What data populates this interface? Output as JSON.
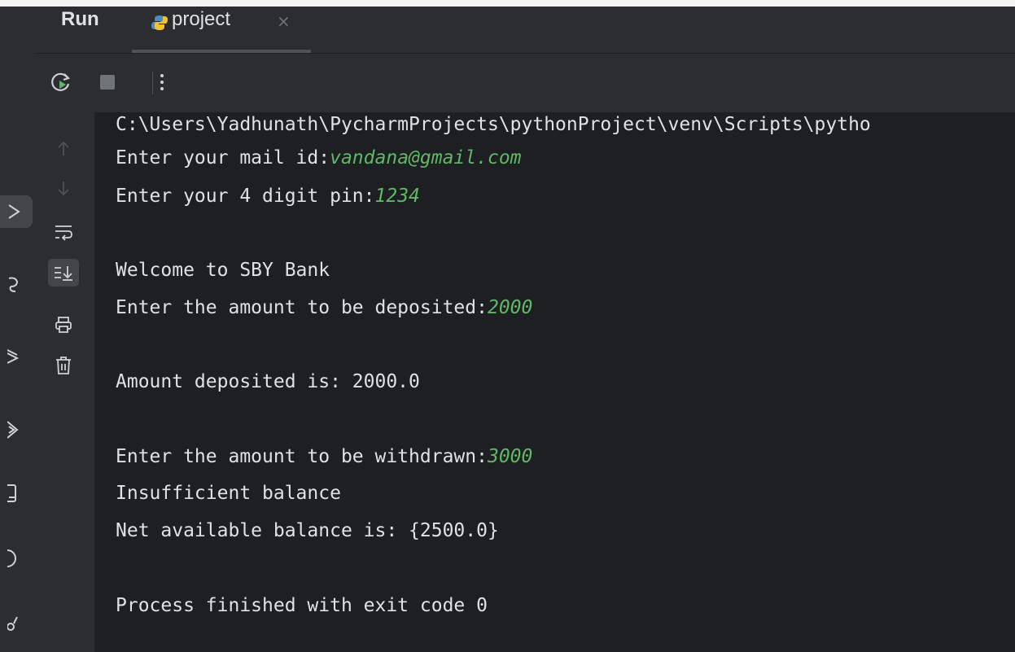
{
  "run_panel": {
    "title": "Run",
    "tab_label": "project",
    "tab_close": "×"
  },
  "toolbar": {
    "icons": [
      "rerun-icon",
      "stop-icon",
      "more-options-icon"
    ]
  },
  "gutter": {
    "icons": [
      "scroll-up-icon",
      "scroll-down-icon",
      "soft-wrap-icon",
      "scroll-to-end-icon",
      "print-icon",
      "clear-all-icon"
    ]
  },
  "console": {
    "line_1": "C:\\Users\\Yadhunath\\PycharmProjects\\pythonProject\\venv\\Scripts\\pytho",
    "line_2_prompt": "Enter your mail id:",
    "line_2_input": "vandana@gmail.com",
    "line_3_prompt": "Enter your 4 digit pin:",
    "line_3_input": "1234",
    "line_4": "Welcome to SBY Bank",
    "line_5_prompt": "Enter the amount to be deposited:",
    "line_5_input": "2000",
    "line_6": "Amount deposited is: 2000.0",
    "line_7_prompt": "Enter the amount to be withdrawn:",
    "line_7_input": "3000",
    "line_8": "Insufficient balance",
    "line_9": "Net available balance is: {2500.0}",
    "line_10": "Process finished with exit code 0"
  },
  "colors": {
    "background": "#1e1f22",
    "panel": "#2b2d30",
    "text": "#dfe1e5",
    "user_input": "#5fb865"
  }
}
